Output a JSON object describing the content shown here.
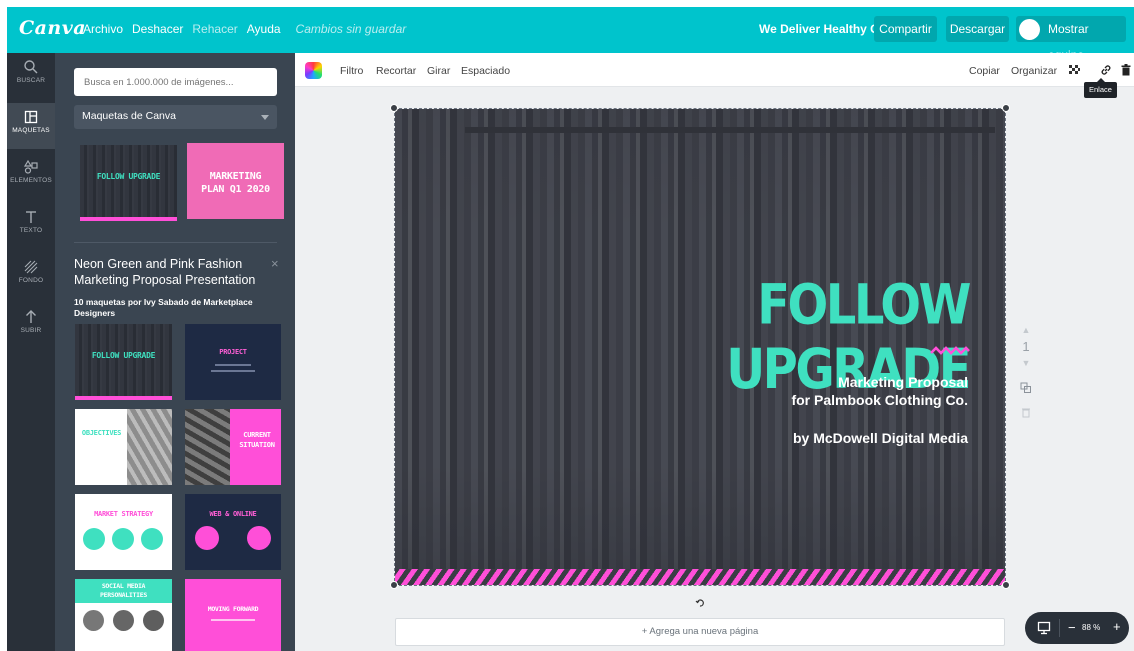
{
  "app": {
    "logo": "Canva"
  },
  "menu": {
    "file": "Archivo",
    "undo": "Deshacer",
    "redo": "Rehacer",
    "help": "Ayuda",
    "status": "Cambios sin guardar"
  },
  "header": {
    "team_name": "We Deliver Healthy Co.",
    "share": "Compartir",
    "download": "Descargar",
    "show_team": "Mostrar equipo"
  },
  "rail": [
    {
      "label": "BUSCAR",
      "icon": "search-icon"
    },
    {
      "label": "MAQUETAS",
      "icon": "layouts-icon"
    },
    {
      "label": "ELEMENTOS",
      "icon": "elements-icon"
    },
    {
      "label": "TEXTO",
      "icon": "text-icon"
    },
    {
      "label": "FONDO",
      "icon": "background-icon"
    },
    {
      "label": "SUBIR",
      "icon": "upload-icon"
    }
  ],
  "panel": {
    "search_placeholder": "Busca en 1.000.000 de imágenes...",
    "select_value": "Maquetas de Canva",
    "featured": [
      {
        "title": "FOLLOW UPGRADE"
      },
      {
        "title1": "MARKETING",
        "title2": "PLAN Q1 2020"
      }
    ],
    "set_title": "Neon Green and Pink Fashion Marketing Proposal Presentation",
    "set_close": "×",
    "set_sub": "10 maquetas por Ivy Sabado de Marketplace Designers",
    "templates": [
      {
        "title": "FOLLOW UPGRADE"
      },
      {
        "title": "PROJECT"
      },
      {
        "title": "OBJECTIVES"
      },
      {
        "title1": "CURRENT",
        "title2": "SITUATION"
      },
      {
        "title": "MARKET STRATEGY"
      },
      {
        "title": "WEB & ONLINE"
      },
      {
        "title1": "SOCIAL MEDIA",
        "title2": "PERSONALITIES"
      },
      {
        "title": "MOVING FORWARD"
      }
    ]
  },
  "toolbar": {
    "filter": "Filtro",
    "crop": "Recortar",
    "flip": "Girar",
    "spacing": "Espaciado",
    "copy": "Copiar",
    "arrange": "Organizar",
    "link_tooltip": "Enlace"
  },
  "canvas": {
    "headline": "FOLLOW UPGRADE",
    "line1": "Marketing Proposal",
    "line2": "for Palmbook Clothing Co.",
    "line3": "by McDowell Digital Media",
    "page_number": "1",
    "add_page": "+ Agrega una nueva página"
  },
  "zoom": {
    "minus": "−",
    "value": "88 %",
    "plus": "+"
  },
  "colors": {
    "brand": "#00c4cc",
    "accent_green": "#3fe0c0",
    "accent_pink": "#ff4fd8",
    "rail": "#293039",
    "panel": "#3a4551"
  }
}
